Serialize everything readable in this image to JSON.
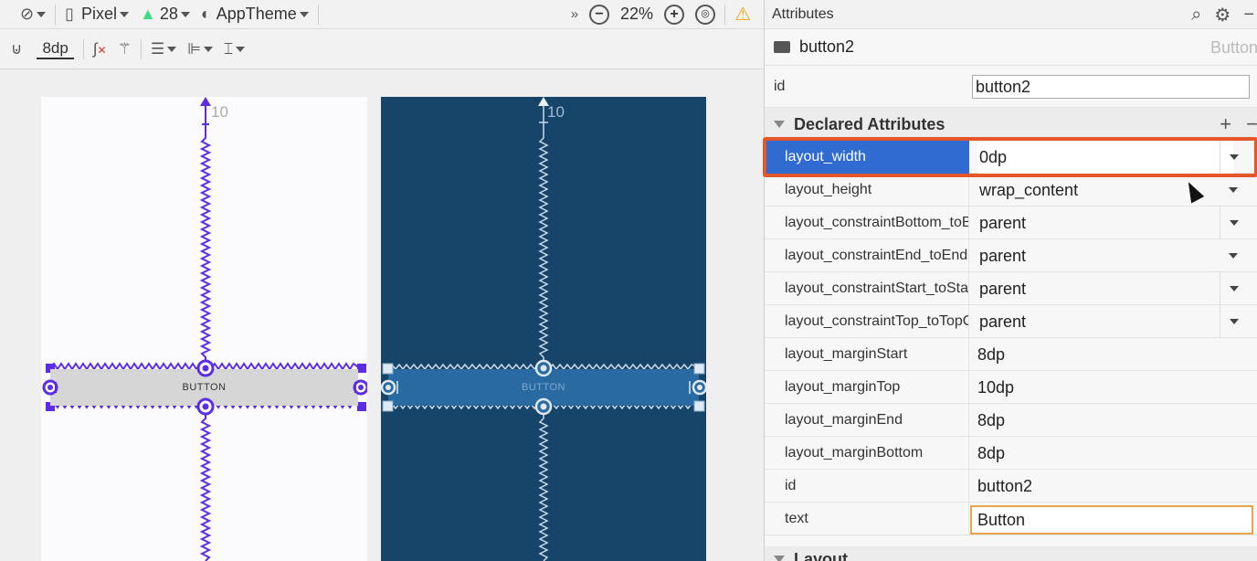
{
  "toolbar_top": {
    "device_label": "Pixel",
    "api_level": "28",
    "theme_label": "AppTheme",
    "more_label": "»",
    "zoom_level": "22%"
  },
  "toolbar_bottom": {
    "margin_value": "8dp"
  },
  "design_canvas": {
    "button_label": "BUTTON",
    "top_margin_label": "10"
  },
  "blueprint_canvas": {
    "button_label": "BUTTON",
    "top_margin_label": "10"
  },
  "panel": {
    "title": "Attributes",
    "component_name": "button2",
    "component_type": "Button",
    "id_label": "id",
    "id_value": "button2",
    "declared_title": "Declared Attributes",
    "layout_title": "Layout",
    "rows": [
      {
        "name": "layout_width",
        "value": "0dp"
      },
      {
        "name": "layout_height",
        "value": "wrap_content"
      },
      {
        "name": "layout_constraintBottom_toBottomOf",
        "value": "parent"
      },
      {
        "name": "layout_constraintEnd_toEndOf",
        "value": "parent"
      },
      {
        "name": "layout_constraintStart_toStartOf",
        "value": "parent"
      },
      {
        "name": "layout_constraintTop_toTopOf",
        "value": "parent"
      },
      {
        "name": "layout_marginStart",
        "value": "8dp"
      },
      {
        "name": "layout_marginTop",
        "value": "10dp"
      },
      {
        "name": "layout_marginEnd",
        "value": "8dp"
      },
      {
        "name": "layout_marginBottom",
        "value": "8dp"
      },
      {
        "name": "id",
        "value": "button2"
      },
      {
        "name": "text",
        "value": "Button"
      }
    ]
  },
  "colors": {
    "selection_blue": "#2f6bd1",
    "highlight_orange": "#e5562a",
    "blueprint_bg": "#17456a",
    "constraint_purple": "#5b2ee6"
  }
}
